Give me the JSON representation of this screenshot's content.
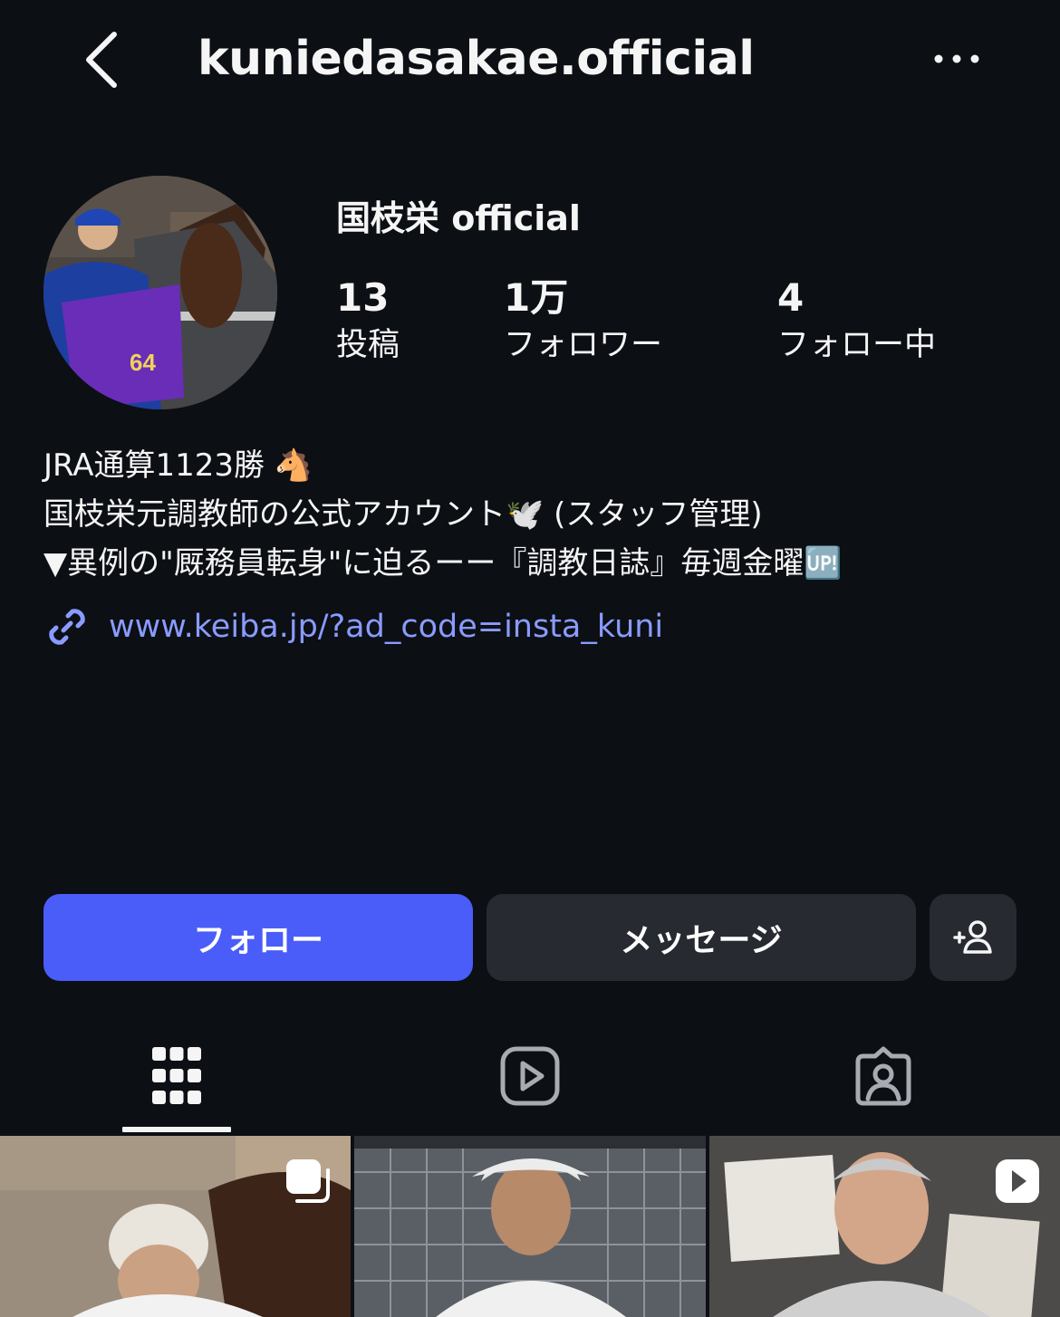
{
  "header": {
    "username": "kuniedasakae.official",
    "back_icon": "chevron-left-icon",
    "more_icon": "more-horizontal-icon"
  },
  "profile": {
    "display_name": "国枝栄 official",
    "avatar_icon": "profile-avatar",
    "stats": [
      {
        "value": "13",
        "label": "投稿"
      },
      {
        "value": "1万",
        "label": "フォロワー"
      },
      {
        "value": "4",
        "label": "フォロー中"
      }
    ]
  },
  "bio": {
    "line1": "JRA通算1123勝 🐴",
    "line2": "国枝栄元調教師の公式アカウント🕊️ (スタッフ管理)",
    "line3": "▼異例の\"厩務員転身\"に迫るーー『調教日誌』毎週金曜🆙",
    "link": "www.keiba.jp/?ad_code=insta_kuni",
    "link_icon": "link-icon"
  },
  "actions": {
    "follow_label": "フォロー",
    "message_label": "メッセージ",
    "suggest_icon": "add-person-icon"
  },
  "tabs": [
    {
      "icon": "grid-icon",
      "active": true
    },
    {
      "icon": "reels-icon",
      "active": false
    },
    {
      "icon": "tagged-icon",
      "active": false
    }
  ],
  "colors": {
    "background": "#0c0f14",
    "follow_button": "#4a5df9",
    "secondary_button": "#272a31",
    "link": "#8a9bff"
  },
  "posts": [
    {
      "type": "carousel",
      "badge_icon": "carousel-icon"
    },
    {
      "type": "photo"
    },
    {
      "type": "reel",
      "badge_icon": "reel-play-icon"
    }
  ]
}
